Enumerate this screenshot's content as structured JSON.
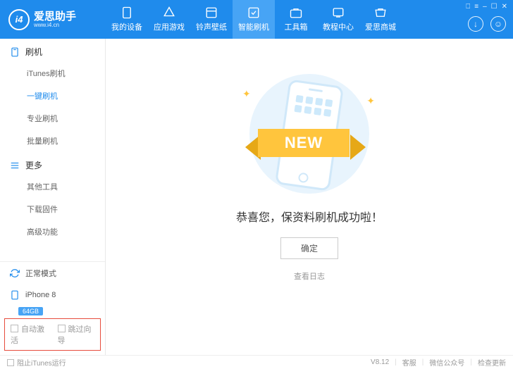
{
  "app": {
    "name": "爱思助手",
    "url": "www.i4.cn",
    "logo_glyph": "i4"
  },
  "win_controls": [
    "⎕",
    "≡",
    "–",
    "☐",
    "✕"
  ],
  "tabs": [
    {
      "label": "我的设备"
    },
    {
      "label": "应用游戏"
    },
    {
      "label": "铃声壁纸"
    },
    {
      "label": "智能刷机",
      "active": true
    },
    {
      "label": "工具箱"
    },
    {
      "label": "教程中心"
    },
    {
      "label": "爱思商城"
    }
  ],
  "sidebar": {
    "sections": [
      {
        "title": "刷机",
        "items": [
          "iTunes刷机",
          "一键刷机",
          "专业刷机",
          "批量刷机"
        ],
        "active_index": 1
      },
      {
        "title": "更多",
        "items": [
          "其他工具",
          "下载固件",
          "高级功能"
        ],
        "active_index": -1
      }
    ],
    "status": "正常模式",
    "device": {
      "name": "iPhone 8",
      "storage": "64GB"
    },
    "options": {
      "auto_activate": "自动激活",
      "skip_wizard": "跳过向导"
    }
  },
  "main": {
    "banner_text": "NEW",
    "message": "恭喜您，保资料刷机成功啦！",
    "ok": "确定",
    "view_log": "查看日志"
  },
  "footer": {
    "block_itunes": "阻止iTunes运行",
    "version": "V8.12",
    "links": [
      "客服",
      "微信公众号",
      "检查更新"
    ]
  }
}
